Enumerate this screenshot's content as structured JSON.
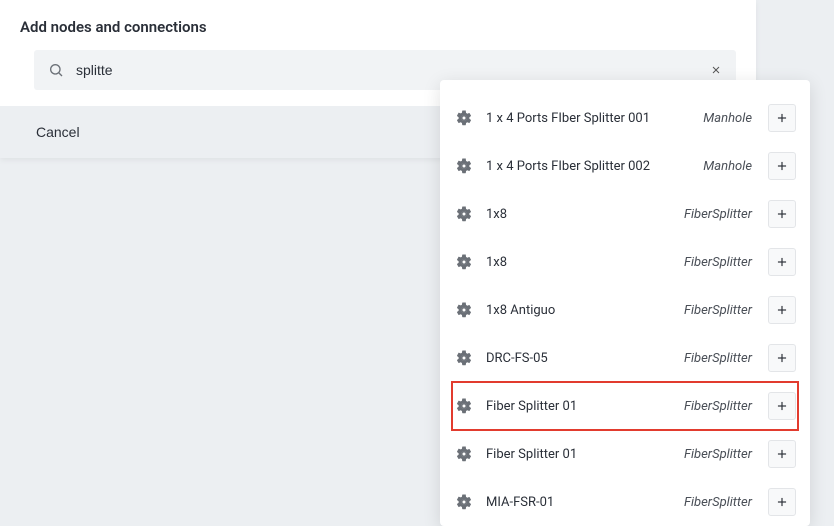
{
  "header": {
    "title": "Add nodes and connections"
  },
  "search": {
    "value": "splitte"
  },
  "footer": {
    "cancel_label": "Cancel"
  },
  "results": [
    {
      "name": "1 x 4 Ports FIber Splitter 001",
      "type": "Manhole",
      "highlighted": false
    },
    {
      "name": "1 x 4 Ports FIber Splitter 002",
      "type": "Manhole",
      "highlighted": false
    },
    {
      "name": "1x8",
      "type": "FiberSplitter",
      "highlighted": false
    },
    {
      "name": "1x8",
      "type": "FiberSplitter",
      "highlighted": false
    },
    {
      "name": "1x8 Antiguo",
      "type": "FiberSplitter",
      "highlighted": false
    },
    {
      "name": "DRC-FS-05",
      "type": "FiberSplitter",
      "highlighted": false
    },
    {
      "name": "Fiber Splitter 01",
      "type": "FiberSplitter",
      "highlighted": true
    },
    {
      "name": "Fiber Splitter 01",
      "type": "FiberSplitter",
      "highlighted": false
    },
    {
      "name": "MIA-FSR-01",
      "type": "FiberSplitter",
      "highlighted": false
    }
  ]
}
